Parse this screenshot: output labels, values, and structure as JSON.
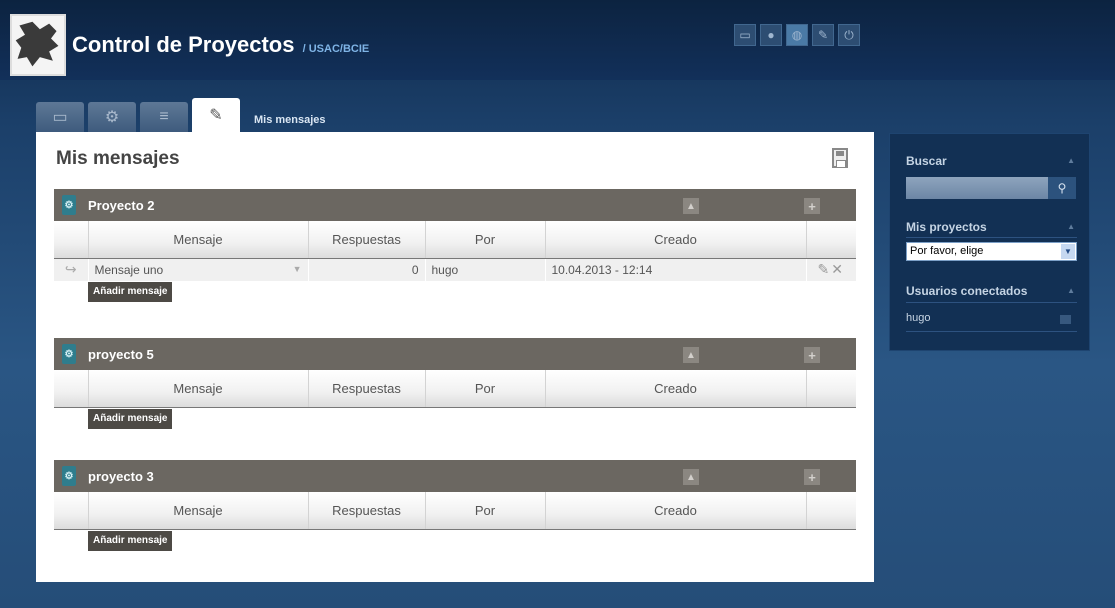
{
  "header": {
    "title": "Control de Proyectos",
    "subtitle": "/ USAC/BCIE",
    "icons": [
      "monitor-icon",
      "user-icon",
      "globe-icon",
      "wrench-icon",
      "power-icon"
    ]
  },
  "tabs": {
    "active_label": "Mis mensajes",
    "icons": [
      "monitor-icon",
      "tools-icon",
      "clipboard-icon",
      "notepad-icon"
    ]
  },
  "main": {
    "page_title": "Mis mensajes",
    "table_headers": {
      "message": "Mensaje",
      "replies": "Respuestas",
      "by": "Por",
      "created": "Creado"
    },
    "add_message_label": "Añadir mensaje",
    "projects": [
      {
        "name": "Proyecto 2",
        "messages": [
          {
            "message": "Mensaje uno",
            "replies": "0",
            "by": "hugo",
            "created": "10.04.2013 - 12:14"
          }
        ]
      },
      {
        "name": "proyecto 5",
        "messages": []
      },
      {
        "name": "proyecto 3",
        "messages": []
      }
    ]
  },
  "sidebar": {
    "search": {
      "title": "Buscar",
      "value": ""
    },
    "my_projects": {
      "title": "Mis proyectos",
      "selected": "Por favor, elige"
    },
    "connected_users": {
      "title": "Usuarios conectados",
      "users": [
        "hugo"
      ]
    }
  },
  "colors": {
    "page_background": "#1f4672",
    "project_header": "#6b6761",
    "button": "#4d4a45"
  }
}
